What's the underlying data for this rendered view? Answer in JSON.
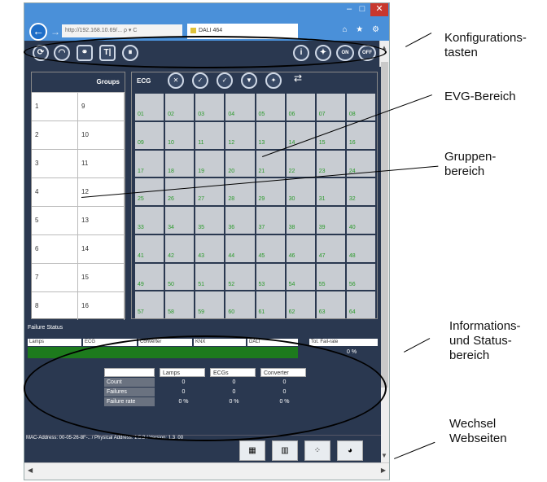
{
  "browser": {
    "address": "http://192.168.10.69/... ρ ▾ C",
    "tab_title": "DALI 464",
    "window_controls": {
      "min": "–",
      "max": "□",
      "close": "✕"
    },
    "right_icons": "⌂ ★ ⚙"
  },
  "toolbar": {
    "btn1": "⟳",
    "btn2": "◠",
    "btn3": "⚭",
    "btn4": "T|",
    "btn5": "⏸",
    "info": "i",
    "bulb": "✦",
    "on": "ON",
    "off": "OFF"
  },
  "groups": {
    "header": "Groups",
    "left": [
      "1",
      "2",
      "3",
      "4",
      "5",
      "6",
      "7",
      "8"
    ],
    "right": [
      "9",
      "10",
      "11",
      "12",
      "13",
      "14",
      "15",
      "16"
    ]
  },
  "ecg": {
    "label": "ECG",
    "cells": [
      "01",
      "02",
      "03",
      "04",
      "05",
      "06",
      "07",
      "08",
      "09",
      "10",
      "11",
      "12",
      "13",
      "14",
      "15",
      "16",
      "17",
      "18",
      "19",
      "20",
      "21",
      "22",
      "23",
      "24",
      "25",
      "26",
      "27",
      "28",
      "29",
      "30",
      "31",
      "32",
      "33",
      "34",
      "35",
      "36",
      "37",
      "38",
      "39",
      "40",
      "41",
      "42",
      "43",
      "44",
      "45",
      "46",
      "47",
      "48",
      "49",
      "50",
      "51",
      "52",
      "53",
      "54",
      "55",
      "56",
      "57",
      "58",
      "59",
      "60",
      "61",
      "62",
      "63",
      "64"
    ]
  },
  "failure": {
    "title": "Failure Status",
    "headers": [
      "Lamps",
      "ECG",
      "Converter",
      "KNX",
      "DALI",
      "Tot. Fail-rate"
    ],
    "total_pct": "0 %",
    "cols": [
      "Lamps",
      "ECGs",
      "Converter"
    ],
    "rows": [
      {
        "label": "Count",
        "values": [
          "0",
          "0",
          "0"
        ]
      },
      {
        "label": "Failures",
        "values": [
          "0",
          "0",
          "0"
        ]
      },
      {
        "label": "Failure rate",
        "values": [
          "0 %",
          "0 %",
          "0 %"
        ]
      }
    ],
    "mac": "MAC-Address: 00-05-26-8F-.. / Physical Address: 1.5.3 / Version: 1.3_00"
  },
  "annotations": {
    "a1": "Konfigurations-\ntasten",
    "a2": "EVG-Bereich",
    "a3": "Gruppen-\nbereich",
    "a4": "Informations-\nund Status-\nbereich",
    "a5": "Wechsel\nWebseiten"
  },
  "colors": {
    "panel": "#2a3850",
    "titlebar": "#4a90d9",
    "green": "#1d7a1d"
  }
}
